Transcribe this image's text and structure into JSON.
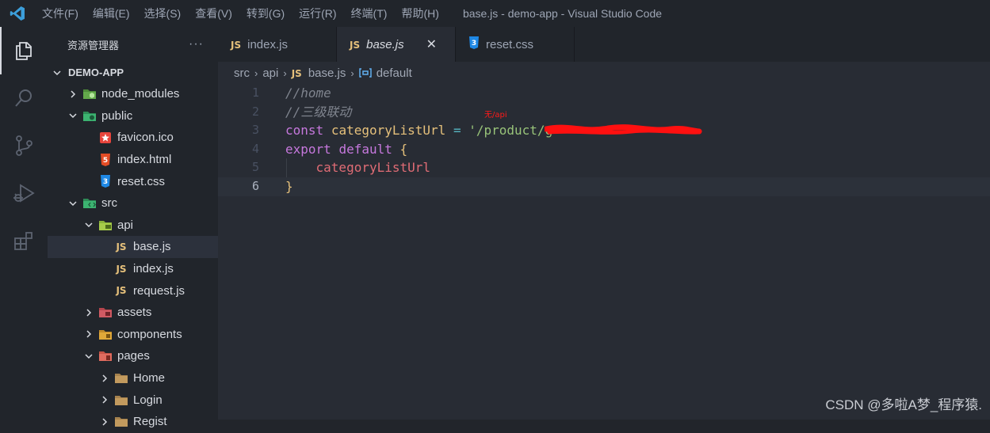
{
  "titlebar": {
    "menu": [
      "文件(F)",
      "编辑(E)",
      "选择(S)",
      "查看(V)",
      "转到(G)",
      "运行(R)",
      "终端(T)",
      "帮助(H)"
    ],
    "window_title": "base.js - demo-app - Visual Studio Code"
  },
  "activity_bar": {
    "icons": [
      "explorer-icon",
      "search-icon",
      "source-control-icon",
      "run-debug-icon",
      "extensions-icon"
    ]
  },
  "sidebar": {
    "header": "资源管理器",
    "more": "···",
    "root": "DEMO-APP",
    "tree": [
      {
        "label": "node_modules",
        "type": "folder",
        "state": "collapsed",
        "depth": 1,
        "icon": "node-folder-icon"
      },
      {
        "label": "public",
        "type": "folder",
        "state": "expanded",
        "depth": 1,
        "icon": "public-folder-icon"
      },
      {
        "label": "favicon.ico",
        "type": "file",
        "depth": 2,
        "icon": "favicon-icon"
      },
      {
        "label": "index.html",
        "type": "file",
        "depth": 2,
        "icon": "html-icon"
      },
      {
        "label": "reset.css",
        "type": "file",
        "depth": 2,
        "icon": "css-icon"
      },
      {
        "label": "src",
        "type": "folder",
        "state": "expanded",
        "depth": 1,
        "icon": "src-folder-icon"
      },
      {
        "label": "api",
        "type": "folder",
        "state": "expanded",
        "depth": 2,
        "icon": "api-folder-icon"
      },
      {
        "label": "base.js",
        "type": "file",
        "depth": 3,
        "icon": "js-icon",
        "selected": true
      },
      {
        "label": "index.js",
        "type": "file",
        "depth": 3,
        "icon": "js-icon"
      },
      {
        "label": "request.js",
        "type": "file",
        "depth": 3,
        "icon": "js-icon"
      },
      {
        "label": "assets",
        "type": "folder",
        "state": "collapsed",
        "depth": 2,
        "icon": "assets-folder-icon"
      },
      {
        "label": "components",
        "type": "folder",
        "state": "collapsed",
        "depth": 2,
        "icon": "components-folder-icon"
      },
      {
        "label": "pages",
        "type": "folder",
        "state": "expanded",
        "depth": 2,
        "icon": "pages-folder-icon"
      },
      {
        "label": "Home",
        "type": "folder",
        "state": "collapsed",
        "depth": 3,
        "icon": "folder-icon"
      },
      {
        "label": "Login",
        "type": "folder",
        "state": "collapsed",
        "depth": 3,
        "icon": "folder-icon"
      },
      {
        "label": "Regist",
        "type": "folder",
        "state": "collapsed",
        "depth": 3,
        "icon": "folder-icon"
      }
    ]
  },
  "tabs": [
    {
      "label": "index.js",
      "icon": "js-icon",
      "active": false
    },
    {
      "label": "base.js",
      "icon": "js-icon",
      "active": true,
      "close": "✕"
    },
    {
      "label": "reset.css",
      "icon": "css-icon",
      "active": false
    }
  ],
  "breadcrumb": {
    "items": [
      "src",
      "api",
      "base.js",
      "default"
    ],
    "separator": "›"
  },
  "code": {
    "lines": [
      {
        "n": "1",
        "comment": "//home"
      },
      {
        "n": "2",
        "comment": "//三级联动"
      },
      {
        "n": "3",
        "kw": "const",
        "name": "categoryListUrl",
        "op": "=",
        "str": "'/product/g"
      },
      {
        "n": "4",
        "kw": "export",
        "kw2": "default",
        "brace": "{"
      },
      {
        "n": "5",
        "prop": "categoryListUrl"
      },
      {
        "n": "6",
        "brace": "}"
      }
    ],
    "current_line": "6"
  },
  "annotation": "无/api",
  "watermark": "CSDN @多啦A梦_程序猿."
}
